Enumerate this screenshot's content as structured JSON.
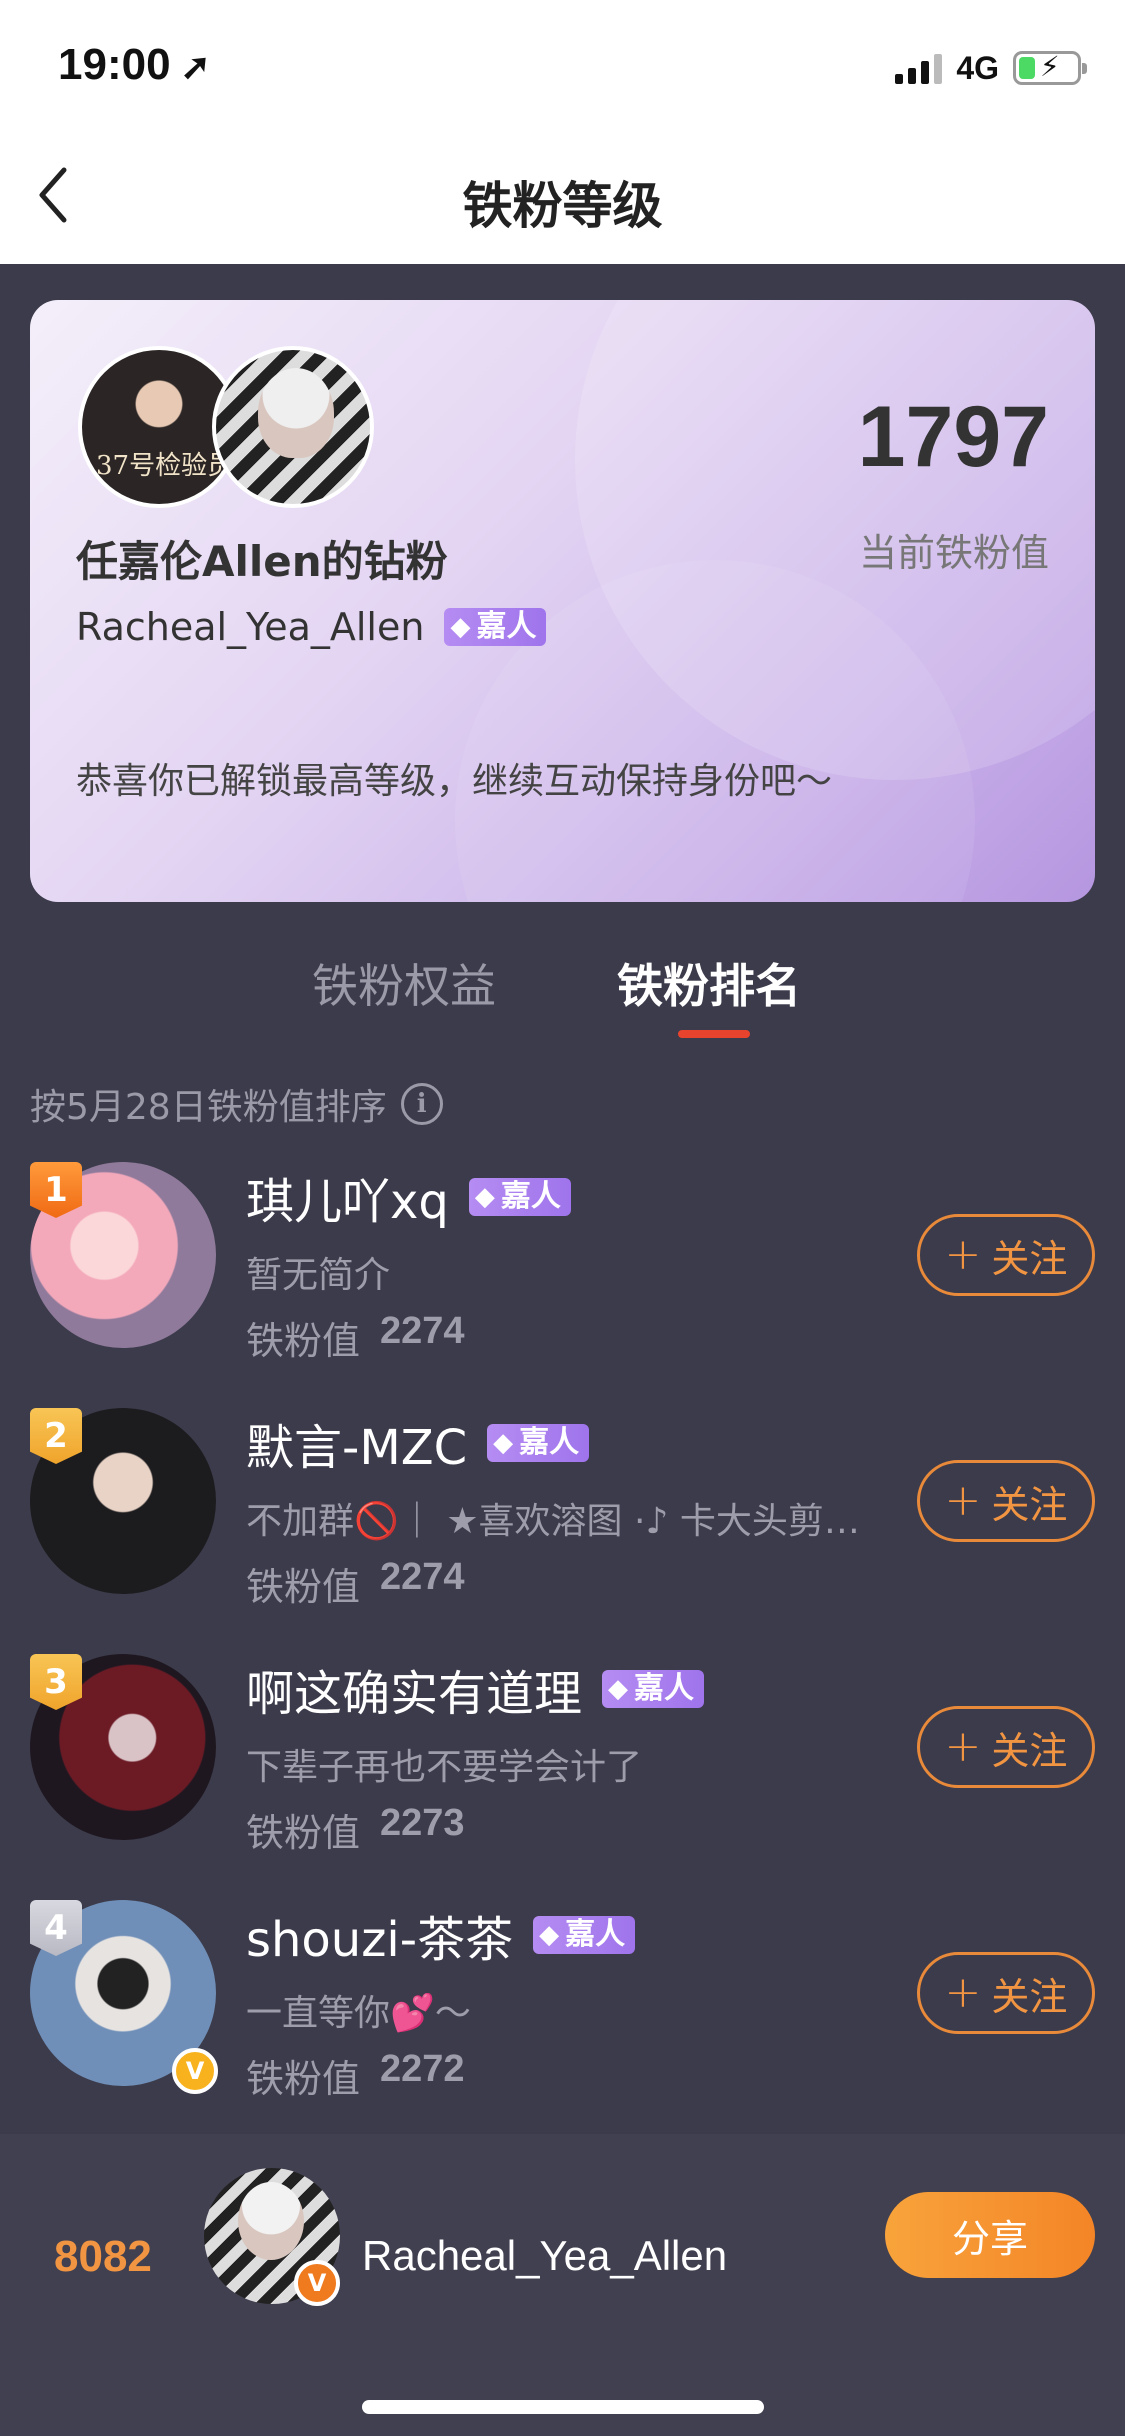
{
  "status": {
    "time": "19:00",
    "network": "4G"
  },
  "nav": {
    "title": "铁粉等级"
  },
  "card": {
    "score": "1797",
    "score_label": "当前铁粉值",
    "fan_title": "任嘉伦Allen的钻粉",
    "username": "Racheal_Yea_Allen",
    "badge": "嘉人",
    "avatar_left_text": "37号检验员",
    "congrats": "恭喜你已解锁最高等级，继续互动保持身份吧～"
  },
  "tabs": [
    {
      "label": "铁粉权益"
    },
    {
      "label": "铁粉排名"
    }
  ],
  "sort_note": "按5月28日铁粉值排序",
  "ranking": [
    {
      "rank": "1",
      "name": "琪儿吖xq",
      "badge": "嘉人",
      "desc": "暂无简介",
      "value_label": "铁粉值",
      "value": "2274",
      "follow": "关注"
    },
    {
      "rank": "2",
      "name": "默言-MZC",
      "badge": "嘉人",
      "desc": "不加群🚫｜ ★喜欢溶图 ·♪ 卡大头剪…",
      "value_label": "铁粉值",
      "value": "2274",
      "follow": "关注"
    },
    {
      "rank": "3",
      "name": "啊这确实有道理",
      "badge": "嘉人",
      "desc": "下辈子再也不要学会计了",
      "value_label": "铁粉值",
      "value": "2273",
      "follow": "关注"
    },
    {
      "rank": "4",
      "name": "shouzi-茶茶",
      "badge": "嘉人",
      "desc": "一直等你💕～",
      "value_label": "铁粉值",
      "value": "2272",
      "follow": "关注"
    }
  ],
  "bottom": {
    "my_rank": "8082",
    "username": "Racheal_Yea_Allen",
    "share": "分享"
  },
  "colors": {
    "accent_orange": "#f29542",
    "tab_underline": "#e8442d",
    "badge_purple": "#a87cf0",
    "background": "#3c3b4b"
  }
}
